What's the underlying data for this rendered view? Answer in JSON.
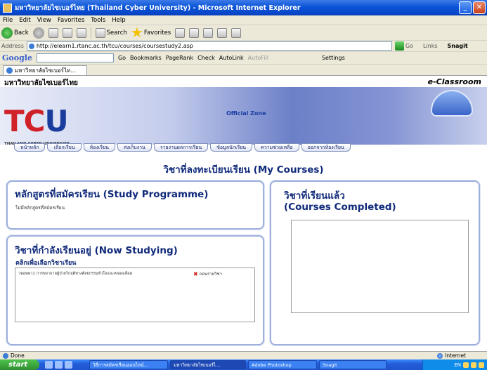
{
  "window": {
    "title": "มหาวิทยาลัยไซเบอร์ไทย (Thailand Cyber University) - Microsoft Internet Explorer",
    "minimize": "_",
    "close": "✕"
  },
  "menu": [
    "File",
    "Edit",
    "View",
    "Favorites",
    "Tools",
    "Help"
  ],
  "toolbar": {
    "back": "Back",
    "search": "Search",
    "favorites": "Favorites"
  },
  "address": {
    "label": "Address",
    "url": "http://elearn1.rtanc.ac.th/tcu/courses/coursestudy2.asp",
    "go": "Go",
    "links": "Links",
    "snagit": "Snagit"
  },
  "google": {
    "logo": "Google",
    "go": "Go",
    "bookmarks": "Bookmarks",
    "pagerank": "PageRank",
    "check": "Check",
    "autolink": "AutoLink",
    "autofill": "AutoFill",
    "settings": "Settings"
  },
  "tab": {
    "label": "มหาวิทยาลัยไซเบอร์ไท..."
  },
  "page": {
    "university_thai": "มหาวิทยาลัยไซเบอร์ไทย",
    "eclassroom": "e-Classroom",
    "logo_t": "T",
    "logo_c": "C",
    "logo_u": "U",
    "logo_sub": "THAILAND CYBER UNIVERSITY",
    "official_zone": "Official Zone",
    "nav": [
      "หน้าหลัก",
      "เลือกเรียน",
      "ห้องเรียน",
      "ส่งเก็บงาน",
      "รายงานผลการเรียน",
      "ข้อมูลนักเรียน",
      "ความช่วยเหลือ",
      "ออกจากห้องเรียน"
    ],
    "heading": "วิชาที่ลงทะเบียนเรียน (My Courses)",
    "study_programme": {
      "title": "หลักสูตรที่สมัครเรียน (Study Programme)",
      "note": "ไม่มีหลักสูตรที่สมัครเรียน"
    },
    "now_studying": {
      "title": "วิชาที่กำลังเรียนอยู่ (Now Studying)",
      "subtitle": "คลิกเพื่อเลือกวิชาเรียน",
      "courses": [
        {
          "name": "วพอพพว1  การพยาบาลผู้ป่วยวิกฤติทางศัลยกรรมหัวใจและหลอดเลือด",
          "action": "ถอนรายวิชา"
        }
      ]
    },
    "courses_completed": {
      "title_line1": "วิชาที่เรียนแล้ว",
      "title_line2": "(Courses Completed)"
    }
  },
  "status": {
    "text": "Done",
    "zone": "Internet"
  },
  "taskbar": {
    "start": "start",
    "tasks": [
      "วิธีการสมัครเรียนออนไลน์...",
      "มหาวิทยาลัยไซเบอร์ไ...",
      "Adobe Photoshop",
      "Snagit"
    ],
    "lang": "EN"
  }
}
